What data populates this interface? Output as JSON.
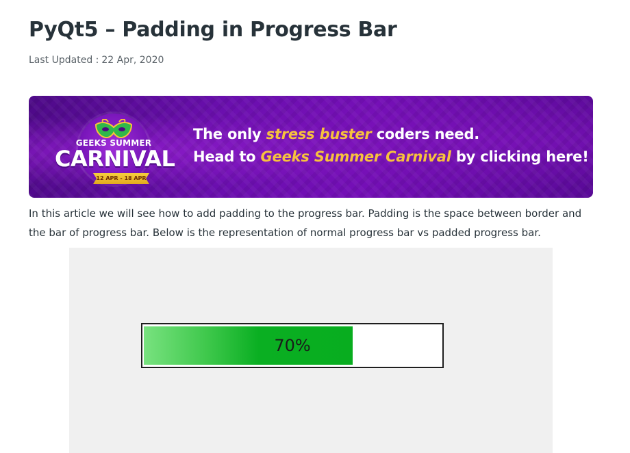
{
  "article": {
    "title": "PyQt5 – Padding in Progress Bar",
    "last_updated_label": "Last Updated :",
    "last_updated_date": "22 Apr, 2020",
    "intro": "In this article we will see how to add padding to the progress bar. Padding is the space between border and the bar of progress bar. Below is the representation of normal progress bar vs padded progress bar."
  },
  "banner": {
    "logo_top": "GEEKS SUMMER",
    "logo_main": "CARNIVAL",
    "logo_dates": "12 APR - 18 APR",
    "line1_before": "The only ",
    "line1_highlight": "stress buster",
    "line1_after": " coders need.",
    "line2_before": "Head to ",
    "line2_highlight": "Geeks Summer Carnival",
    "line2_after": " by clicking here!",
    "colors": {
      "background": "#6a0fae",
      "highlight": "#f7c23d",
      "text": "#ffffff"
    }
  },
  "figure": {
    "progress_value": 0.7,
    "progress_text": "70%",
    "colors": {
      "fill": "#0aaf22",
      "fill_light": "#78e27f",
      "background": "#f0f0f0",
      "border": "#1e1e1e"
    }
  }
}
